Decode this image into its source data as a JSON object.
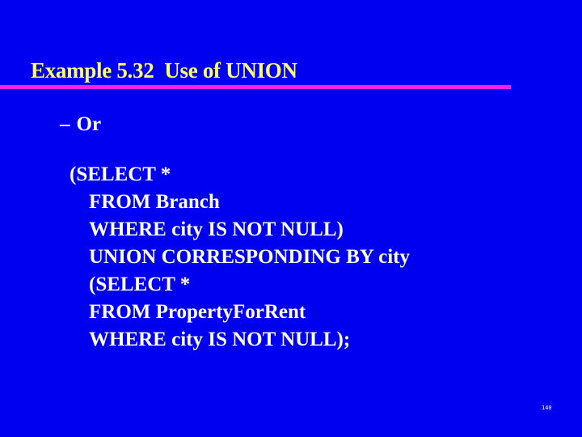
{
  "slide": {
    "title": "Example 5.32  Use of UNION",
    "colors": {
      "background": "#0000f0",
      "title": "#ffff66",
      "rule": "#ff20e0",
      "text": "#ffffff"
    },
    "bullet": {
      "marker": "–",
      "text": "Or"
    },
    "code_lines": [
      "(SELECT *",
      "FROM Branch",
      "WHERE city IS NOT NULL)",
      "UNION CORRESPONDING BY city",
      "(SELECT *",
      "FROM PropertyForRent",
      "WHERE city IS NOT NULL);"
    ],
    "page_number": "140"
  }
}
